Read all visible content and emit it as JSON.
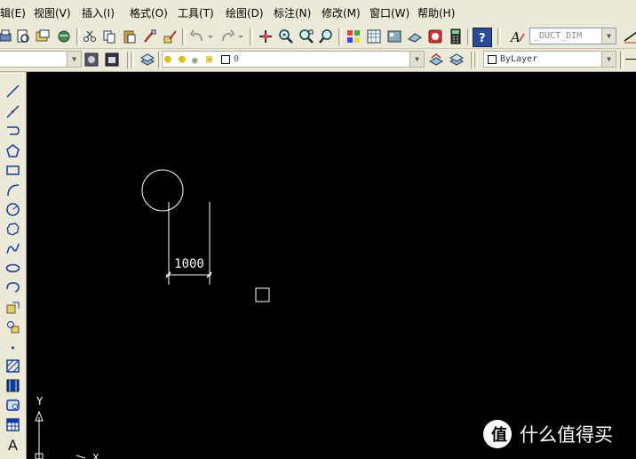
{
  "menubar": {
    "items": [
      "辑(E)",
      "视图(V)",
      "插入(I)",
      "格式(O)",
      "工具(T)",
      "绘图(D)",
      "标注(N)",
      "修改(M)",
      "窗口(W)",
      "帮助(H)"
    ]
  },
  "toolbar": {
    "dimstyle_value": "_DUCT_DIM",
    "layer_value": "0",
    "color_value": "ByLayer"
  },
  "drawing": {
    "dimension_text": "1000",
    "ucs_y_label": "Y",
    "ucs_x_label": "X"
  },
  "watermark": {
    "text": "什么值得买"
  },
  "colors": {
    "chrome": "#ece9d8",
    "canvas": "#000000",
    "lines": "#ffffff"
  }
}
